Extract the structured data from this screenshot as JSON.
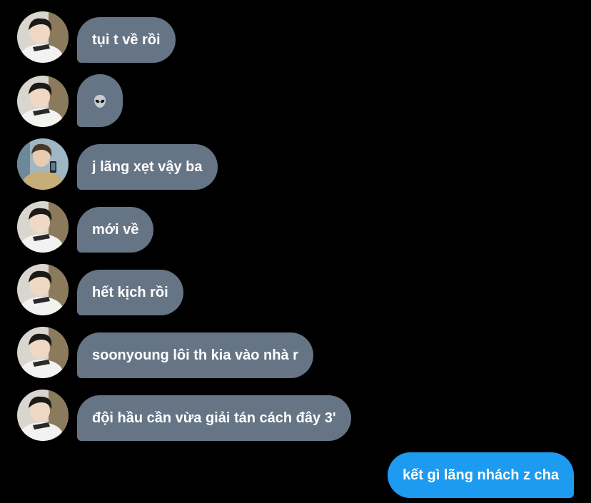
{
  "messages": [
    {
      "sender": "other",
      "avatar": "boy-with-pen",
      "text": "tụi t về rồi"
    },
    {
      "sender": "other",
      "avatar": "boy-with-pen",
      "emoji": "alien-icon",
      "text": ""
    },
    {
      "sender": "other",
      "avatar": "boy-with-phone",
      "text": "j lãng xẹt vậy ba"
    },
    {
      "sender": "other",
      "avatar": "boy-with-pen",
      "text": "mới về"
    },
    {
      "sender": "other",
      "avatar": "boy-with-pen",
      "text": "hết kịch rồi"
    },
    {
      "sender": "other",
      "avatar": "boy-with-pen",
      "text": "soonyoung lôi th kia vào nhà r"
    },
    {
      "sender": "other",
      "avatar": "boy-with-pen",
      "text": "đội hầu cần vừa giải tán cách đây 3'"
    },
    {
      "sender": "self",
      "text": "kết gì lãng nhách z cha"
    }
  ],
  "colors": {
    "background": "#000000",
    "incoming_bubble": "#667585",
    "outgoing_bubble": "#1d9bf0",
    "text": "#ffffff"
  }
}
